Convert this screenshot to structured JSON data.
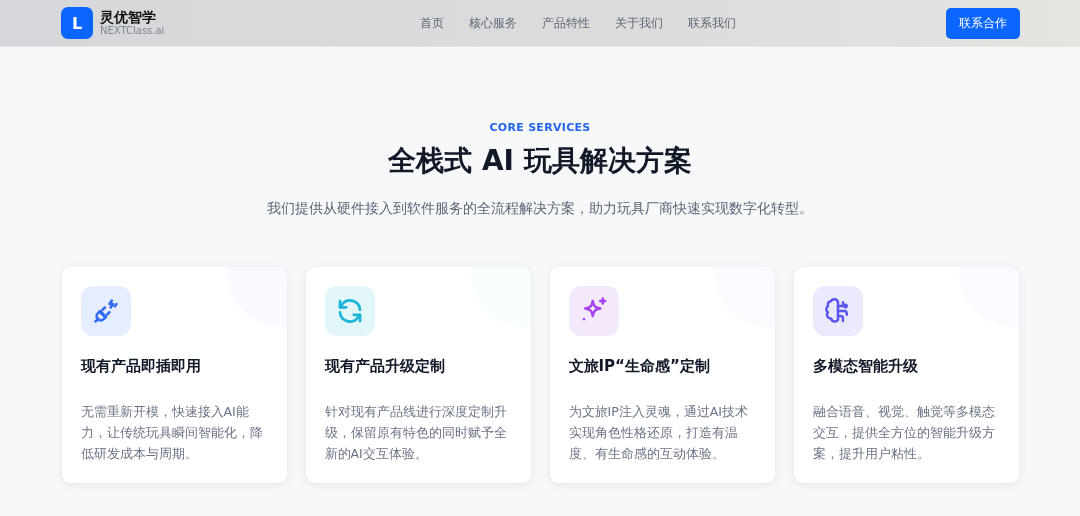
{
  "header": {
    "logo_letter": "L",
    "brand": "灵优智学",
    "brand_sub": "NEXTClass.ai",
    "nav": [
      {
        "label": "首页"
      },
      {
        "label": "核心服务"
      },
      {
        "label": "产品特性"
      },
      {
        "label": "关于我们"
      },
      {
        "label": "联系我们"
      }
    ],
    "cta": "联系合作"
  },
  "section": {
    "eyebrow": "CORE SERVICES",
    "title": "全栈式 AI 玩具解决方案",
    "subtitle": "我们提供从硬件接入到软件服务的全流程解决方案，助力玩具厂商快速实现数字化转型。"
  },
  "cards": [
    {
      "kind": "plug",
      "color": "#2f6bf5",
      "title": "现有产品即插即用",
      "text": "无需重新开模，快速接入AI能力，让传统玩具瞬间智能化，降低研发成本与周期。"
    },
    {
      "kind": "refresh",
      "color": "#1cb5d8",
      "title": "现有产品升级定制",
      "text": "针对现有产品线进行深度定制升级，保留原有特色的同时赋予全新的AI交互体验。"
    },
    {
      "kind": "sparkle",
      "color": "#a63ff0",
      "title": "文旅IP“生命感”定制",
      "text": "为文旅IP注入灵魂，通过AI技术实现角色性格还原，打造有温度、有生命感的互动体验。"
    },
    {
      "kind": "brain",
      "color": "#5b55f0",
      "title": "多模态智能升级",
      "text": "融合语音、视觉、触觉等多模态交互，提供全方位的智能升级方案，提升用户粘性。"
    }
  ]
}
